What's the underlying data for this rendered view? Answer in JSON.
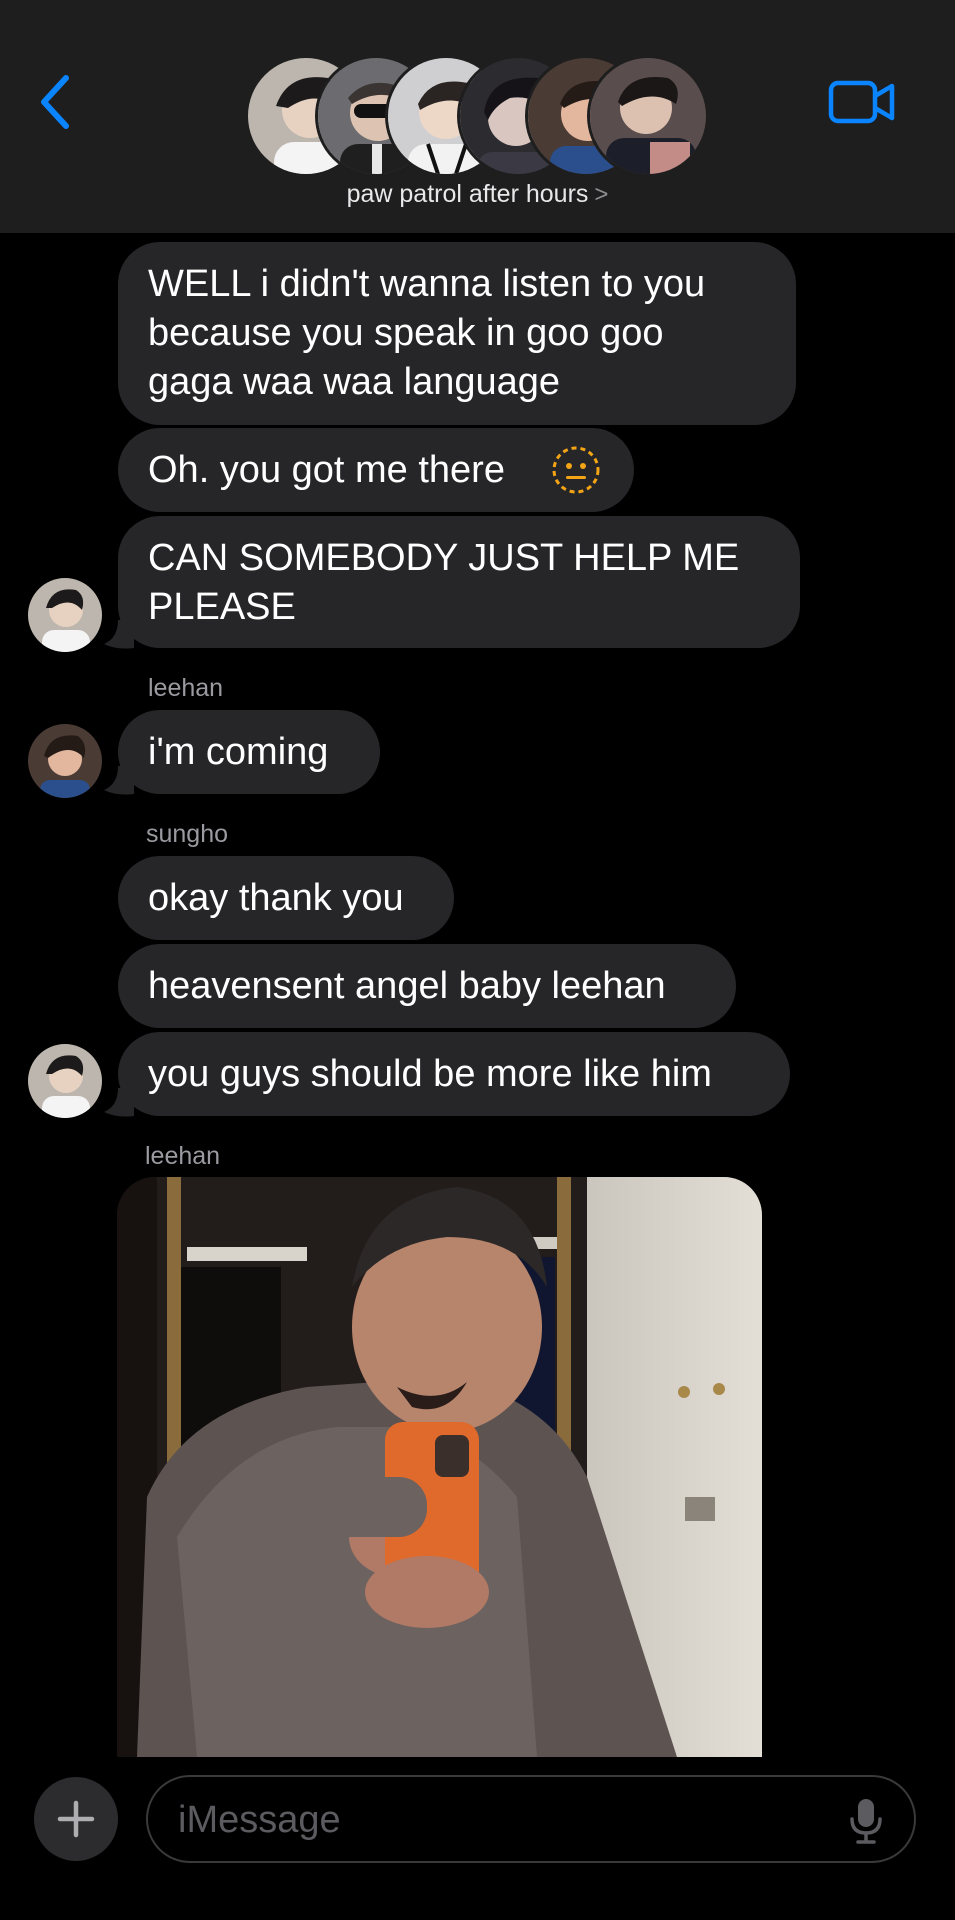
{
  "header": {
    "title": "paw patrol after hours",
    "chevron": ">",
    "accent_color": "#0a84ff",
    "back_icon": "chevron-left-icon",
    "video_icon": "video-camera-icon"
  },
  "messages": [
    {
      "text_lines": [
        "WELL i didn't wanna listen to you",
        "because you speak in goo goo",
        "gaga waa waa language"
      ]
    },
    {
      "text": "Oh. you got me there",
      "emoji": "dotted-neutral-face-emoji"
    },
    {
      "text_lines": [
        "CAN SOMEBODY JUST HELP ME",
        "PLEASE"
      ]
    },
    {
      "sender": "leehan",
      "text": "i'm coming"
    },
    {
      "sender": "sungho",
      "text": "okay thank you"
    },
    {
      "text": "heavensent angel baby leehan"
    },
    {
      "text": "you guys should be more like him"
    },
    {
      "sender": "leehan",
      "attachment": "photo-attachment"
    }
  ],
  "composer": {
    "placeholder": "iMessage",
    "plus_icon": "plus-icon",
    "mic_icon": "microphone-icon"
  }
}
